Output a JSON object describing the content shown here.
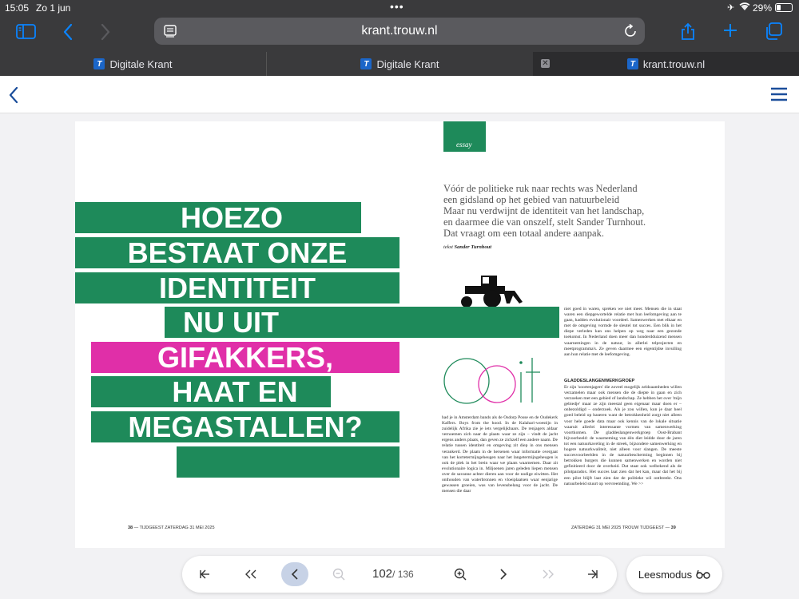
{
  "status_bar": {
    "time": "15:05",
    "date": "Zo 1 jun",
    "battery": "29%"
  },
  "browser": {
    "url": "krant.trouw.nl",
    "tabs": [
      {
        "label": "Digitale Krant",
        "favicon": "T"
      },
      {
        "label": "Digitale Krant",
        "favicon": "T"
      },
      {
        "label": "krant.trouw.nl",
        "favicon": "T"
      }
    ]
  },
  "article": {
    "section": "essay",
    "headline": [
      "HOEZO",
      "BESTAAT ONZE",
      "IDENTITEIT",
      "NU UIT",
      "GIFAKKERS,",
      "HAAT EN",
      "MEGASTALLEN?"
    ],
    "intro": [
      "Vóór de politieke ruk naar rechts was Nederland",
      "een gidsland op het gebied van natuurbeleid",
      "Maar nu verdwijnt de identiteit van het landschap,",
      "en daarmee die van onszelf, stelt Sander Turnhout.",
      "Dat vraagt om een totaal andere aanpak."
    ],
    "byline_label": "tekst",
    "byline_name": "Sander Turnhout",
    "drop_word": "Ooit",
    "col1": "had je in Amsterdam bands als de Osdorp Posse en de Oudekerk Kaffers. Boys from the hood. In de Kalahari-woestijn in zuidelijk Afrika zie je iets vergelijkbaars. De renjagers aldaar vernoemen zich naar de plaats waar ze zijn – vindt de jacht ergens anders plaats, dan geven ze zichzelf een andere naam. De relatie tussen identiteit en omgeving zit diep in ons mensen verankerd. De plaats in de hersenen waar informatie overgaat van het kortetermijngeheugen naar het langetermijngeheugen is ook de plek in het brein waar we plaats waarnemen. Daar zit evolutionaire logica in. Miljoenen jaren geleden liepen mensen over de savanne achter dieren aan voor de nodige eiwitten. Het onthouden van waterbronnen en vloeiplaatsen waar eenjarige gewassen groeien, was van levensbelang voor de jacht. De mensen die daar",
    "col2_a": "niet goed in waren, spreken we niet meer. Mensen die in staat waren een diepgewortelde relatie met hun leefomgeving aan te gaan, hadden evolutionair voordeel. Samenwerken met elkaar en met de omgeving vormde de sleutel tot succes. Een blik in het diepe verleden kan ons helpen op weg naar een gezonde toekomst. In Nederland doen meer dan honderdduizend mensen waarnemingen in de natuur, in allerlei telprojecten en meetprogramma's. Ze geven daarmee een eigentijdse invulling aan hun relatie met de leefomgeving.",
    "subhead": "GLADDESLANGENWERKGROEP",
    "col2_b": "Er zijn 'soortenjagers' die zoveel mogelijk zeldzaamheden willen verzamelen maar ook mensen die de diepte in gaan en zich verzoeken met een gebied of landschap. Ze hebben het over 'mijn gebiedje' maar ze zijn meestal geen eigenaar maar doen er – onbezoldigd – onderzoek. Als je zou willen, kun je daar heel goed beleid op baseren want de betrokkenheid zorgt niet alleen voor hele goede data maar ook kennis van de lokale situatie waaruit allerlei interessante vormen van samenwerking voortkomen. De gladdeslangenwerkgroep Oost-Brabant bijvoorbeeld: de waarneming van één diet leidde door de jaren tot een natuurkaveling in de streek, bijzondere samenwerking en hogere natuurkwaliteit, niet alleen voor slangen. De meeste succesvoorbeelden in de natuurbescherming beginnen bij betrokken burgers die kunnen samenwerken en worden niet gefinitieerd door de overheid. Dat staat ook welbekend als de pilotparadox. Het succes laat zien dat het kan, maar dat het bij een pilot blijft laat zien dat de politieke wil ontbreekt. Ons natuurbeleid stuurt op vervreemding. We >>",
    "footer_left": {
      "page": "38",
      "section": "TIJDGEEST",
      "date": "ZATERDAG 31 MEI 2025"
    },
    "footer_right": {
      "date": "ZATERDAG 31 MEI 2025",
      "paper": "TROUW",
      "section": "TIJDGEEST",
      "page": "39"
    }
  },
  "pdf_toolbar": {
    "current_page": "102",
    "total_pages": "/ 136",
    "reader_label": "Leesmodus"
  },
  "icons": [
    "sidebar-icon",
    "back-icon",
    "forward-icon",
    "reader-icon",
    "reload-icon",
    "share-icon",
    "plus-icon",
    "tabs-icon",
    "menu-icon",
    "first-page-icon",
    "prev-double-icon",
    "prev-icon",
    "zoom-out-icon",
    "zoom-in-icon",
    "next-icon",
    "next-double-icon",
    "last-page-icon",
    "glasses-icon"
  ],
  "colors": {
    "accent_green": "#1e8a5a",
    "accent_pink": "#e02fa8",
    "ios_blue": "#0a84ff",
    "trouw_blue": "#1b66c9"
  }
}
